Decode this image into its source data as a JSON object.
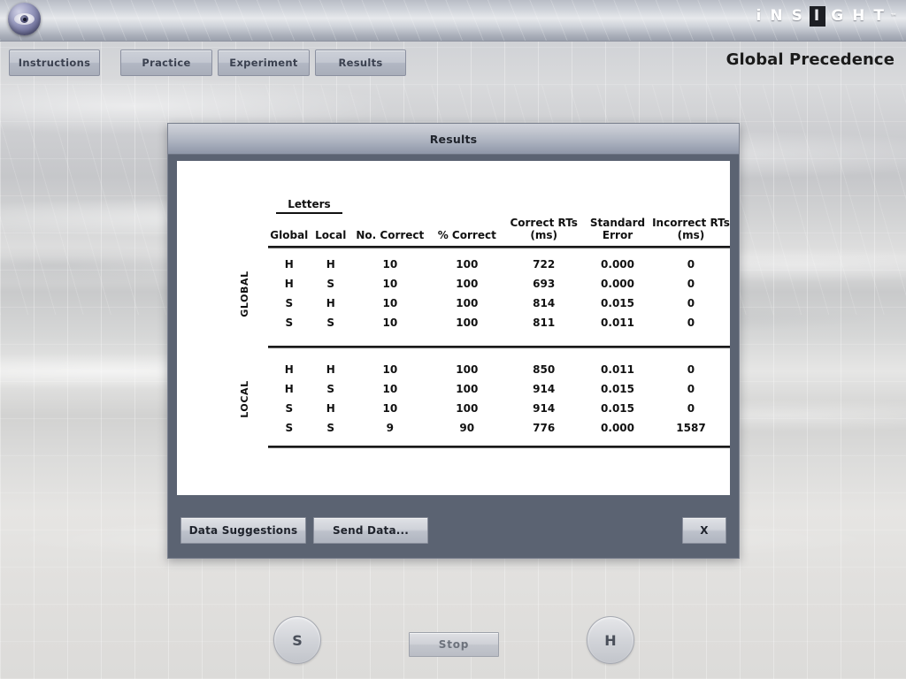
{
  "header": {
    "logo_icon": "eye-icon",
    "brand_letters": [
      "i",
      "N",
      "S",
      "I",
      "G",
      "H",
      "T"
    ],
    "brand_boxed_index": 3,
    "trademark": "™"
  },
  "tabs": [
    {
      "id": "instructions",
      "label": "Instructions"
    },
    {
      "id": "practice",
      "label": "Practice"
    },
    {
      "id": "experiment",
      "label": "Experiment"
    },
    {
      "id": "results",
      "label": "Results"
    }
  ],
  "app_title": "Global Precedence",
  "dialog": {
    "title": "Results",
    "buttons": {
      "data_suggestions": "Data Suggestions",
      "send_data": "Send Data...",
      "close": "X"
    }
  },
  "table": {
    "group_header": "Letters",
    "columns": [
      "Global",
      "Local",
      "No. Correct",
      "% Correct",
      "Correct RTs\n(ms)",
      "Standard\nError",
      "Incorrect RTs\n(ms)"
    ],
    "columns_line1": [
      "Global",
      "Local",
      "No. Correct",
      "% Correct",
      "Correct RTs",
      "Standard",
      "Incorrect RTs"
    ],
    "columns_line2": [
      "",
      "",
      "",
      "",
      "(ms)",
      "Error",
      "(ms)"
    ],
    "sections": [
      {
        "label": "GLOBAL",
        "bold_column": "global",
        "rows": [
          {
            "global": "H",
            "local": "H",
            "no_correct": "10",
            "pct_correct": "100",
            "correct_rt": "722",
            "standard_error": "0.000",
            "incorrect_rt": "0"
          },
          {
            "global": "H",
            "local": "S",
            "no_correct": "10",
            "pct_correct": "100",
            "correct_rt": "693",
            "standard_error": "0.000",
            "incorrect_rt": "0"
          },
          {
            "global": "S",
            "local": "H",
            "no_correct": "10",
            "pct_correct": "100",
            "correct_rt": "814",
            "standard_error": "0.015",
            "incorrect_rt": "0"
          },
          {
            "global": "S",
            "local": "S",
            "no_correct": "10",
            "pct_correct": "100",
            "correct_rt": "811",
            "standard_error": "0.011",
            "incorrect_rt": "0"
          }
        ]
      },
      {
        "label": "LOCAL",
        "bold_column": "local",
        "rows": [
          {
            "global": "H",
            "local": "H",
            "no_correct": "10",
            "pct_correct": "100",
            "correct_rt": "850",
            "standard_error": "0.011",
            "incorrect_rt": "0"
          },
          {
            "global": "H",
            "local": "S",
            "no_correct": "10",
            "pct_correct": "100",
            "correct_rt": "914",
            "standard_error": "0.015",
            "incorrect_rt": "0"
          },
          {
            "global": "S",
            "local": "H",
            "no_correct": "10",
            "pct_correct": "100",
            "correct_rt": "914",
            "standard_error": "0.015",
            "incorrect_rt": "0"
          },
          {
            "global": "S",
            "local": "S",
            "no_correct": "9",
            "pct_correct": "90",
            "correct_rt": "776",
            "standard_error": "0.000",
            "incorrect_rt": "1587"
          }
        ]
      }
    ]
  },
  "controls": {
    "left_response": "S",
    "right_response": "H",
    "stop": "Stop"
  },
  "colors": {
    "dialog_panel": "#5b6372",
    "titlebar_top": "#cfd2da",
    "titlebar_bottom": "#8e96a7",
    "tab_face": "#c3c7d1",
    "text_dark": "#111111"
  }
}
